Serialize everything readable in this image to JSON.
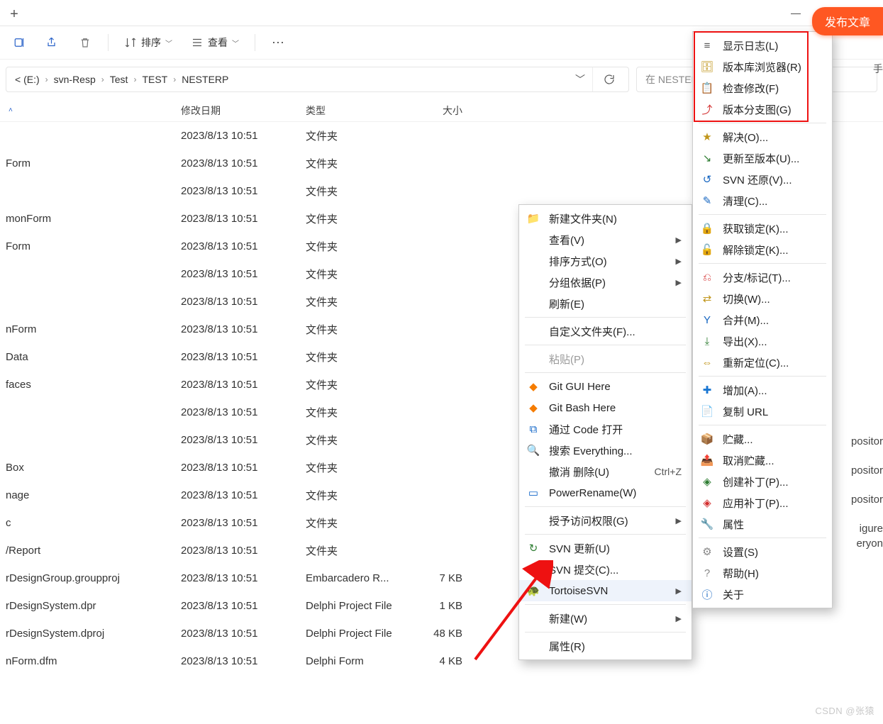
{
  "window_controls": {
    "minimize": "—",
    "maximize": "▢",
    "close": "✕"
  },
  "publish_label": "发布文章",
  "side_hint": "手",
  "side_frags": [
    "positor",
    "positor",
    "positor",
    "igure",
    "eryon"
  ],
  "toolbar": {
    "sort_label": "排序",
    "view_label": "查看"
  },
  "breadcrumbs": [
    "< (E:)",
    "svn-Resp",
    "Test",
    "TEST",
    "NESTERP"
  ],
  "search_placeholder": "在 NESTERP 中搜索",
  "columns": {
    "name": "",
    "date": "修改日期",
    "type": "类型",
    "size": "大小"
  },
  "rows": [
    {
      "name": "",
      "date": "2023/8/13 10:51",
      "type": "文件夹",
      "size": ""
    },
    {
      "name": "Form",
      "date": "2023/8/13 10:51",
      "type": "文件夹",
      "size": ""
    },
    {
      "name": "",
      "date": "2023/8/13 10:51",
      "type": "文件夹",
      "size": ""
    },
    {
      "name": "monForm",
      "date": "2023/8/13 10:51",
      "type": "文件夹",
      "size": ""
    },
    {
      "name": "Form",
      "date": "2023/8/13 10:51",
      "type": "文件夹",
      "size": ""
    },
    {
      "name": "",
      "date": "2023/8/13 10:51",
      "type": "文件夹",
      "size": ""
    },
    {
      "name": "",
      "date": "2023/8/13 10:51",
      "type": "文件夹",
      "size": ""
    },
    {
      "name": "nForm",
      "date": "2023/8/13 10:51",
      "type": "文件夹",
      "size": ""
    },
    {
      "name": "Data",
      "date": "2023/8/13 10:51",
      "type": "文件夹",
      "size": ""
    },
    {
      "name": "faces",
      "date": "2023/8/13 10:51",
      "type": "文件夹",
      "size": ""
    },
    {
      "name": "",
      "date": "2023/8/13 10:51",
      "type": "文件夹",
      "size": ""
    },
    {
      "name": "",
      "date": "2023/8/13 10:51",
      "type": "文件夹",
      "size": ""
    },
    {
      "name": "Box",
      "date": "2023/8/13 10:51",
      "type": "文件夹",
      "size": ""
    },
    {
      "name": "nage",
      "date": "2023/8/13 10:51",
      "type": "文件夹",
      "size": ""
    },
    {
      "name": "c",
      "date": "2023/8/13 10:51",
      "type": "文件夹",
      "size": ""
    },
    {
      "name": "/Report",
      "date": "2023/8/13 10:51",
      "type": "文件夹",
      "size": ""
    },
    {
      "name": "rDesignGroup.groupproj",
      "date": "2023/8/13 10:51",
      "type": "Embarcadero R...",
      "size": "7 KB"
    },
    {
      "name": "rDesignSystem.dpr",
      "date": "2023/8/13 10:51",
      "type": "Delphi Project File",
      "size": "1 KB"
    },
    {
      "name": "rDesignSystem.dproj",
      "date": "2023/8/13 10:51",
      "type": "Delphi Project File",
      "size": "48 KB"
    },
    {
      "name": "nForm.dfm",
      "date": "2023/8/13 10:51",
      "type": "Delphi Form",
      "size": "4 KB"
    }
  ],
  "ctx1": [
    {
      "label": "新建文件夹(N)",
      "icon": "📁",
      "c": "#1e88e5"
    },
    {
      "label": "查看(V)",
      "sub": true
    },
    {
      "label": "排序方式(O)",
      "sub": true
    },
    {
      "label": "分组依据(P)",
      "sub": true
    },
    {
      "label": "刷新(E)"
    },
    {
      "sep": true
    },
    {
      "label": "自定义文件夹(F)..."
    },
    {
      "sep": true
    },
    {
      "label": "粘贴(P)",
      "disabled": true
    },
    {
      "sep": true
    },
    {
      "label": "Git GUI Here",
      "icon": "◆",
      "c": "#f57c00"
    },
    {
      "label": "Git Bash Here",
      "icon": "◆",
      "c": "#f57c00"
    },
    {
      "label": "通过 Code 打开",
      "icon": "⧉",
      "c": "#0d63c7"
    },
    {
      "label": "搜索 Everything...",
      "icon": "🔍",
      "c": "#f57c00"
    },
    {
      "label": "撤消 删除(U)",
      "acc": "Ctrl+Z"
    },
    {
      "label": "PowerRename(W)",
      "icon": "▭",
      "c": "#0d63c7"
    },
    {
      "sep": true
    },
    {
      "label": "授予访问权限(G)",
      "sub": true
    },
    {
      "sep": true
    },
    {
      "label": "SVN 更新(U)",
      "icon": "↻",
      "c": "#2e7d32"
    },
    {
      "label": "SVN 提交(C)...",
      "icon": "↻",
      "c": "#2e7d32"
    },
    {
      "label": "TortoiseSVN",
      "icon": "🐢",
      "c": "#1976d2",
      "hover": true,
      "sub": true
    },
    {
      "sep": true
    },
    {
      "label": "新建(W)",
      "sub": true
    },
    {
      "sep": true
    },
    {
      "label": "属性(R)"
    }
  ],
  "ctx2": [
    {
      "label": "显示日志(L)",
      "icon": "≡",
      "c": "#555"
    },
    {
      "label": "版本库浏览器(R)",
      "icon": "🗄",
      "c": "#c0951a"
    },
    {
      "label": "检查修改(F)",
      "icon": "📋",
      "c": "#607d8b"
    },
    {
      "label": "版本分支图(G)",
      "icon": "⤴",
      "c": "#d32f2f"
    },
    {
      "sep": true
    },
    {
      "label": "解决(O)...",
      "icon": "★",
      "c": "#c0951a"
    },
    {
      "label": "更新至版本(U)...",
      "icon": "↘",
      "c": "#2e7d32"
    },
    {
      "label": "SVN 还原(V)...",
      "icon": "↺",
      "c": "#1565c0"
    },
    {
      "label": "清理(C)...",
      "icon": "✎",
      "c": "#1565c0"
    },
    {
      "sep": true
    },
    {
      "label": "获取锁定(K)...",
      "icon": "🔒",
      "c": "#c0951a"
    },
    {
      "label": "解除锁定(K)...",
      "icon": "🔓",
      "c": "#c0951a"
    },
    {
      "sep": true
    },
    {
      "label": "分支/标记(T)...",
      "icon": "⎌",
      "c": "#d32f2f"
    },
    {
      "label": "切换(W)...",
      "icon": "⇄",
      "c": "#c0951a"
    },
    {
      "label": "合并(M)...",
      "icon": "Y",
      "c": "#1565c0"
    },
    {
      "label": "导出(X)...",
      "icon": "⤓",
      "c": "#2e7d32"
    },
    {
      "label": "重新定位(C)...",
      "icon": "⇔",
      "c": "#c0951a"
    },
    {
      "sep": true
    },
    {
      "label": "增加(A)...",
      "icon": "✚",
      "c": "#1976d2"
    },
    {
      "label": "复制 URL",
      "icon": "📄",
      "c": "#607d8b"
    },
    {
      "sep": true
    },
    {
      "label": "贮藏...",
      "icon": "📦",
      "c": "#1976d2"
    },
    {
      "label": "取消贮藏...",
      "icon": "📤",
      "c": "#1976d2"
    },
    {
      "label": "创建补丁(P)...",
      "icon": "◈",
      "c": "#2e7d32"
    },
    {
      "label": "应用补丁(P)...",
      "icon": "◈",
      "c": "#d32f2f"
    },
    {
      "label": "属性",
      "icon": "🔧",
      "c": "#888"
    },
    {
      "sep": true
    },
    {
      "label": "设置(S)",
      "icon": "⚙",
      "c": "#888"
    },
    {
      "label": "帮助(H)",
      "icon": "?",
      "c": "#888"
    },
    {
      "label": "关于",
      "icon": "ⓘ",
      "c": "#1565c0"
    }
  ],
  "watermark": "CSDN @张猿"
}
